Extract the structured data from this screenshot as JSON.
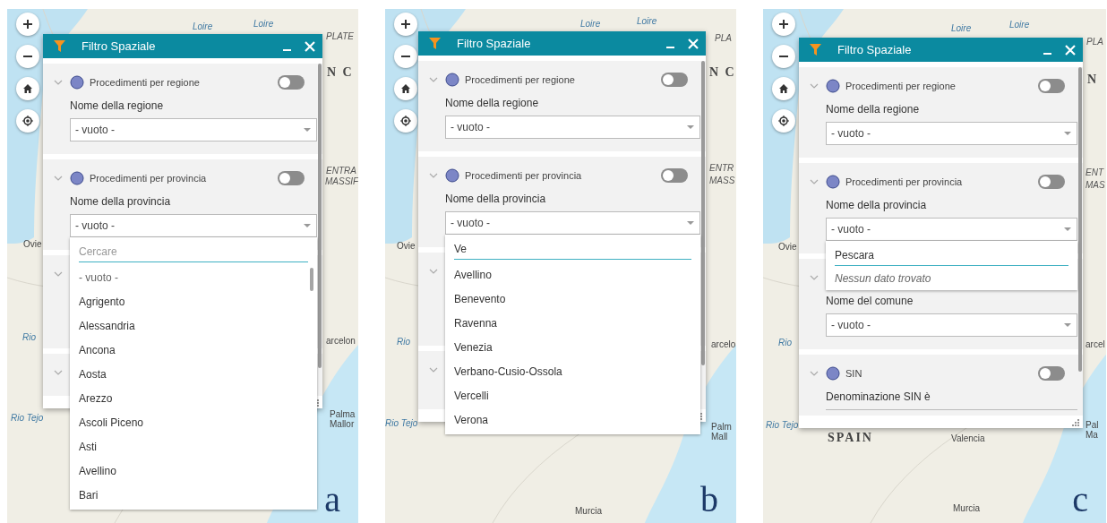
{
  "panels": [
    {
      "letter": "a",
      "map_labels": [
        {
          "text": "Loire",
          "kind": "river"
        },
        {
          "text": "Loire",
          "kind": "river"
        },
        {
          "text": "PLATE",
          "kind": "region"
        },
        {
          "text": "N C",
          "kind": "country"
        },
        {
          "text": "ENTRA",
          "kind": "region"
        },
        {
          "text": "MASSIF",
          "kind": "region"
        },
        {
          "text": "Ovie",
          "kind": "city"
        },
        {
          "text": "Rio",
          "kind": "river"
        },
        {
          "text": "arcelon",
          "kind": "city"
        },
        {
          "text": "Rio Tejo",
          "kind": "river"
        },
        {
          "text": "Palma",
          "kind": "city"
        },
        {
          "text": "Mallor",
          "kind": "city"
        }
      ],
      "widget": {
        "title": "Filtro Spaziale",
        "sections": [
          {
            "kind": "filter",
            "name": "Procedimenti per regione",
            "on": false,
            "field_label": "Nome della regione",
            "value": "- vuoto -"
          },
          {
            "kind": "filter",
            "name": "Procedimenti per provincia",
            "on": false,
            "field_label": "Nome della provincia",
            "value": "- vuoto -"
          },
          {
            "kind": "covered"
          },
          {
            "kind": "covered"
          }
        ]
      },
      "dropdown": {
        "search": {
          "placeholder": "Cercare"
        },
        "scrollable": true,
        "options": [
          {
            "label": "- vuoto -",
            "kind": "empty"
          },
          {
            "label": "Agrigento",
            "kind": "item"
          },
          {
            "label": "Alessandria",
            "kind": "item"
          },
          {
            "label": "Ancona",
            "kind": "item"
          },
          {
            "label": "Aosta",
            "kind": "item"
          },
          {
            "label": "Arezzo",
            "kind": "item"
          },
          {
            "label": "Ascoli Piceno",
            "kind": "item"
          },
          {
            "label": "Asti",
            "kind": "item"
          },
          {
            "label": "Avellino",
            "kind": "item"
          },
          {
            "label": "Bari",
            "kind": "item"
          }
        ]
      }
    },
    {
      "letter": "b",
      "map_labels": [
        {
          "text": "Loire",
          "kind": "river"
        },
        {
          "text": "Loire",
          "kind": "river"
        },
        {
          "text": "PLA",
          "kind": "region"
        },
        {
          "text": "N C",
          "kind": "country"
        },
        {
          "text": "ENTR",
          "kind": "region"
        },
        {
          "text": "MASS",
          "kind": "region"
        },
        {
          "text": "Ovie",
          "kind": "city"
        },
        {
          "text": "Rio",
          "kind": "river"
        },
        {
          "text": "arcelo",
          "kind": "city"
        },
        {
          "text": "Rio Tejo",
          "kind": "river"
        },
        {
          "text": "Palm",
          "kind": "city"
        },
        {
          "text": "Mall",
          "kind": "city"
        },
        {
          "text": "Murcia",
          "kind": "city"
        }
      ],
      "widget": {
        "title": "Filtro Spaziale",
        "sections": [
          {
            "kind": "filter",
            "name": "Procedimenti per regione",
            "on": false,
            "field_label": "Nome della regione",
            "value": "- vuoto -"
          },
          {
            "kind": "filter",
            "name": "Procedimenti per provincia",
            "on": false,
            "field_label": "Nome della provincia",
            "value": "- vuoto -"
          },
          {
            "kind": "covered"
          },
          {
            "kind": "covered"
          }
        ]
      },
      "dropdown": {
        "search": {
          "value": "Ve"
        },
        "scrollable": false,
        "options": [
          {
            "label": "Avellino",
            "kind": "item"
          },
          {
            "label": "Benevento",
            "kind": "item"
          },
          {
            "label": "Ravenna",
            "kind": "item"
          },
          {
            "label": "Venezia",
            "kind": "item"
          },
          {
            "label": "Verbano-Cusio-Ossola",
            "kind": "item"
          },
          {
            "label": "Vercelli",
            "kind": "item"
          },
          {
            "label": "Verona",
            "kind": "item"
          }
        ]
      }
    },
    {
      "letter": "c",
      "map_labels": [
        {
          "text": "Loire",
          "kind": "river"
        },
        {
          "text": "Loire",
          "kind": "river"
        },
        {
          "text": "PLA",
          "kind": "region"
        },
        {
          "text": "N",
          "kind": "country"
        },
        {
          "text": "ENT",
          "kind": "region"
        },
        {
          "text": "MAS",
          "kind": "region"
        },
        {
          "text": "Ovie",
          "kind": "city"
        },
        {
          "text": "Rio",
          "kind": "river"
        },
        {
          "text": "arcel",
          "kind": "city"
        },
        {
          "text": "Rio Tejo",
          "kind": "river"
        },
        {
          "text": "Pal",
          "kind": "city"
        },
        {
          "text": "SPAIN",
          "kind": "country"
        },
        {
          "text": "Valencia",
          "kind": "city"
        },
        {
          "text": "Ma",
          "kind": "city"
        },
        {
          "text": "Murcia",
          "kind": "city"
        }
      ],
      "widget": {
        "title": "Filtro Spaziale",
        "sections": [
          {
            "kind": "filter",
            "name": "Procedimenti per regione",
            "on": false,
            "field_label": "Nome della regione",
            "value": "- vuoto -"
          },
          {
            "kind": "filter",
            "name": "Procedimenti per provincia",
            "on": false,
            "field_label": "Nome della provincia",
            "value": "- vuoto -"
          },
          {
            "kind": "filter",
            "field_label": "Nome del comune",
            "value": "- vuoto -"
          },
          {
            "kind": "filter",
            "name": "SIN",
            "on": false,
            "field_label": "Denominazione SIN è"
          }
        ]
      },
      "dropdown": {
        "search": {
          "value": "Pescara"
        },
        "message": "Nessun dato trovato"
      }
    }
  ]
}
